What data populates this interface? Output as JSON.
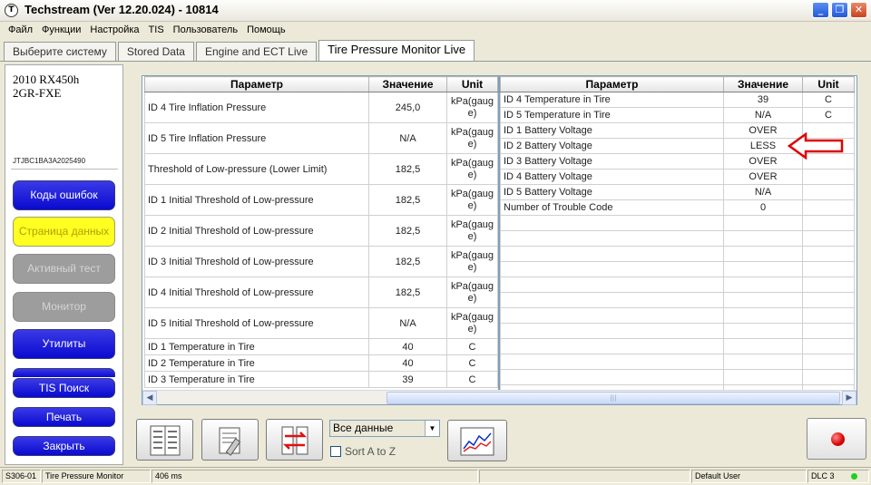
{
  "window": {
    "title": "Techstream (Ver 12.20.024) - 10814"
  },
  "menu": [
    "Файл",
    "Функции",
    "Настройка",
    "TIS",
    "Пользователь",
    "Помощь"
  ],
  "tabs": [
    {
      "label": "Выберите систему",
      "active": false
    },
    {
      "label": "Stored Data",
      "active": false
    },
    {
      "label": "Engine and ECT Live",
      "active": false
    },
    {
      "label": "Tire Pressure Monitor Live",
      "active": true
    }
  ],
  "vehicle": {
    "model_line1": "2010 RX450h",
    "model_line2": "2GR-FXE",
    "vin": "JTJBC1BA3A2025490"
  },
  "sidebar": {
    "codes": "Коды ошибок",
    "data_page": "Страница данных",
    "active_test": "Активный тест",
    "monitor": "Монитор",
    "utilities": "Утилиты",
    "tis_search": "TIS Поиск",
    "print": "Печать",
    "close": "Закрыть"
  },
  "table_headers": {
    "param": "Параметр",
    "value": "Значение",
    "unit": "Unit"
  },
  "left_rows": [
    {
      "param": "ID 4 Tire Inflation Pressure",
      "value": "245,0",
      "unit": "kPa(gauge)"
    },
    {
      "param": "ID 5 Tire Inflation Pressure",
      "value": "N/A",
      "unit": "kPa(gauge)"
    },
    {
      "param": "Threshold of Low-pressure (Lower Limit)",
      "value": "182,5",
      "unit": "kPa(gauge)"
    },
    {
      "param": "ID 1 Initial Threshold of Low-pressure",
      "value": "182,5",
      "unit": "kPa(gauge)"
    },
    {
      "param": "ID 2 Initial Threshold of Low-pressure",
      "value": "182,5",
      "unit": "kPa(gauge)"
    },
    {
      "param": "ID 3 Initial Threshold of Low-pressure",
      "value": "182,5",
      "unit": "kPa(gauge)"
    },
    {
      "param": "ID 4 Initial Threshold of Low-pressure",
      "value": "182,5",
      "unit": "kPa(gauge)"
    },
    {
      "param": "ID 5 Initial Threshold of Low-pressure",
      "value": "N/A",
      "unit": "kPa(gauge)"
    },
    {
      "param": "ID 1 Temperature in Tire",
      "value": "40",
      "unit": "C"
    },
    {
      "param": "ID 2 Temperature in Tire",
      "value": "40",
      "unit": "C"
    },
    {
      "param": "ID 3 Temperature in Tire",
      "value": "39",
      "unit": "C"
    }
  ],
  "right_rows": [
    {
      "param": "ID 4 Temperature in Tire",
      "value": "39",
      "unit": "C"
    },
    {
      "param": "ID 5 Temperature in Tire",
      "value": "N/A",
      "unit": "C"
    },
    {
      "param": "ID 1 Battery Voltage",
      "value": "OVER",
      "unit": ""
    },
    {
      "param": "ID 2 Battery Voltage",
      "value": "LESS",
      "unit": ""
    },
    {
      "param": "ID 3 Battery Voltage",
      "value": "OVER",
      "unit": ""
    },
    {
      "param": "ID 4 Battery Voltage",
      "value": "OVER",
      "unit": ""
    },
    {
      "param": "ID 5 Battery Voltage",
      "value": "N/A",
      "unit": ""
    },
    {
      "param": "Number of Trouble Code",
      "value": "0",
      "unit": ""
    },
    {
      "param": "",
      "value": "",
      "unit": ""
    },
    {
      "param": "",
      "value": "",
      "unit": ""
    },
    {
      "param": "",
      "value": "",
      "unit": ""
    },
    {
      "param": "",
      "value": "",
      "unit": ""
    },
    {
      "param": "",
      "value": "",
      "unit": ""
    },
    {
      "param": "",
      "value": "",
      "unit": ""
    },
    {
      "param": "",
      "value": "",
      "unit": ""
    },
    {
      "param": "",
      "value": "",
      "unit": ""
    },
    {
      "param": "",
      "value": "",
      "unit": ""
    },
    {
      "param": "",
      "value": "",
      "unit": ""
    },
    {
      "param": "",
      "value": "",
      "unit": ""
    },
    {
      "param": "",
      "value": "",
      "unit": ""
    }
  ],
  "toolbar": {
    "dropdown_value": "Все данные",
    "sort_label": "Sort A to Z"
  },
  "status": {
    "code": "S306-01",
    "system": "Tire Pressure Monitor",
    "timing": "406 ms",
    "user": "Default User",
    "dlc": "DLC 3"
  },
  "colors": {
    "annotation_arrow": "#e00000",
    "active_btn": "#0a0ad0",
    "data_page_btn": "#ffff22",
    "record": "#d80000"
  }
}
